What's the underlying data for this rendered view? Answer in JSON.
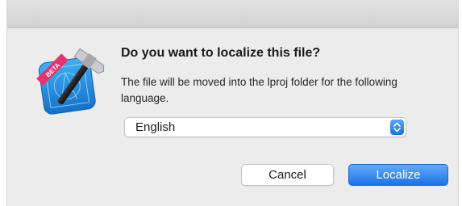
{
  "dialog": {
    "title": "Do you want to localize this file?",
    "message": "The file will be moved into the lproj folder for the following language."
  },
  "icon": {
    "name": "xcode-beta-icon",
    "badge_text": "BETA"
  },
  "language_select": {
    "selected": "English"
  },
  "buttons": {
    "cancel": "Cancel",
    "localize": "Localize"
  },
  "colors": {
    "accent": "#1b72e6",
    "background": "#ececec"
  }
}
